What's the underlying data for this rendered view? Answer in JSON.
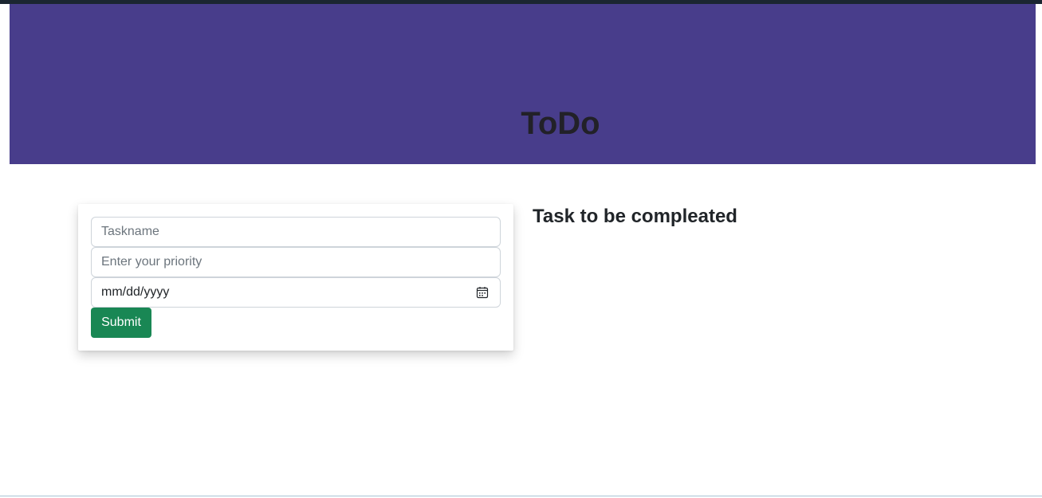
{
  "header": {
    "title": "ToDo",
    "background_color": "#483d8b"
  },
  "form": {
    "taskname": {
      "value": "",
      "placeholder": "Taskname"
    },
    "priority": {
      "value": "",
      "placeholder": "Enter your priority"
    },
    "date": {
      "display": "mm/dd/yyyy",
      "icon": "calendar-icon"
    },
    "submit_label": "Submit",
    "submit_color": "#198754"
  },
  "tasks": {
    "heading": "Task to be compleated",
    "items": []
  }
}
